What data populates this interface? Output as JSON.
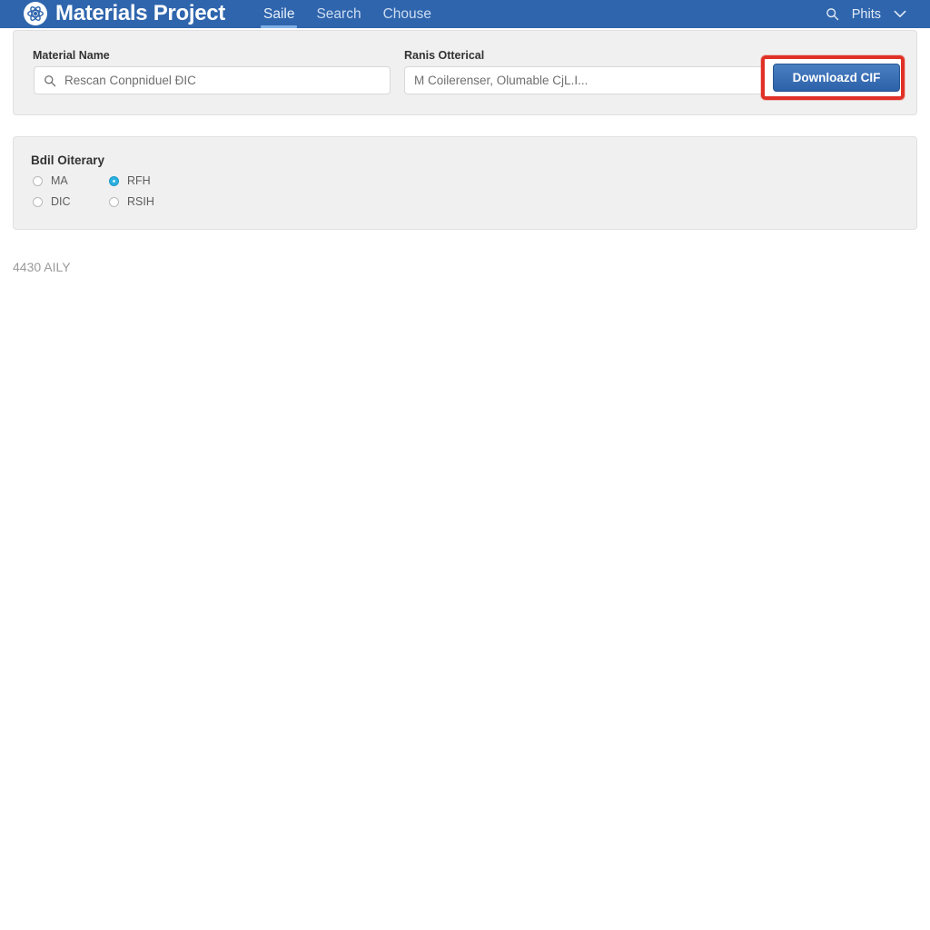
{
  "header": {
    "brand": "Materials Project",
    "logo_icon": "atom-circle-icon",
    "nav": [
      {
        "label": "Saile",
        "active": true
      },
      {
        "label": "Search",
        "active": false
      },
      {
        "label": "Chouse",
        "active": false
      }
    ],
    "search_icon": "search-icon",
    "account_label": "Phits",
    "caret_icon": "chevron-down-icon",
    "bar_color": "#2f65ad",
    "active_underline_color": "#7fb0e4"
  },
  "search_card": {
    "material": {
      "label": "Material Name",
      "icon": "search-icon",
      "value": "",
      "placeholder": "Rescan Conpniduel ÐIC"
    },
    "range": {
      "label": "Ranis Otterical",
      "value": "",
      "placeholder": "M Coilerenser, Olumable CjL.I..."
    },
    "download_button": {
      "label": "Downloazd CIF",
      "highlighted": true,
      "highlight_color": "#e03127",
      "button_color": "#2d62aa"
    }
  },
  "options_card": {
    "title": "Bdil Oiterary",
    "radios": [
      {
        "label": "MA",
        "checked": false
      },
      {
        "label": "RFH",
        "checked": true
      },
      {
        "label": "DIC",
        "checked": false
      },
      {
        "label": "RSIH",
        "checked": false
      }
    ],
    "selected_color": "#29b0e0"
  },
  "footer": {
    "status": "4430 AILY"
  }
}
